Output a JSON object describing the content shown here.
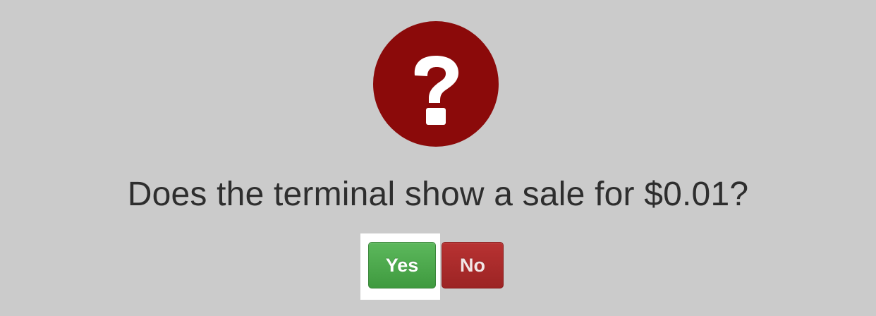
{
  "dialog": {
    "icon": "question-circle-icon",
    "icon_color": "#8b0a0a",
    "prompt": "Does the terminal show a sale for $0.01?",
    "buttons": {
      "yes_label": "Yes",
      "no_label": "No"
    },
    "colors": {
      "yes": "#449d44",
      "no": "#a52a2a",
      "background": "#cbcbcb"
    }
  }
}
